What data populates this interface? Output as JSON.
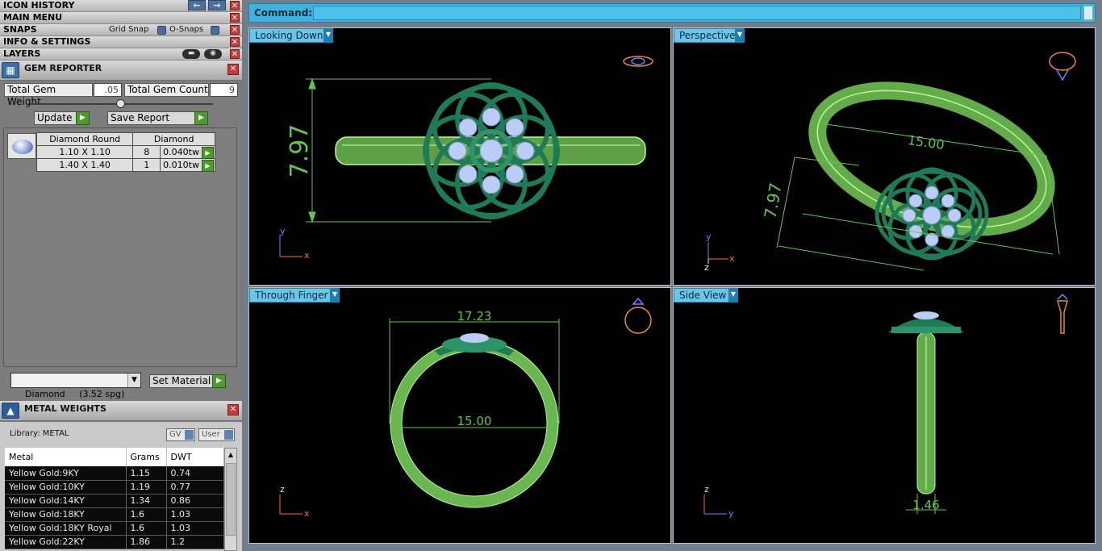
{
  "left_panel": {
    "icon_history": {
      "label": "ICON HISTORY"
    },
    "main_menu": {
      "label": "MAIN MENU"
    },
    "snaps": {
      "label": "SNAPS",
      "grid_snap": "Grid Snap",
      "o_snaps": "O-Snaps"
    },
    "info_settings": {
      "label": "INFO & SETTINGS"
    },
    "layers": {
      "label": "LAYERS"
    },
    "gem_reporter": {
      "title": "GEM REPORTER",
      "total_gem_weight_label": "Total Gem Weight",
      "total_gem_weight_value": ".05",
      "total_gem_count_label": "Total Gem Count",
      "total_gem_count_value": "9",
      "update_label": "Update",
      "save_report_label": "Save Report",
      "table_headers": [
        "Diamond Round",
        "Diamond"
      ],
      "rows": [
        {
          "size": "1.10 X 1.10",
          "count": "8",
          "weight": "0.040tw"
        },
        {
          "size": "1.40 X 1.40",
          "count": "1",
          "weight": "0.010tw"
        }
      ],
      "material_select": "Diamond     (3.52 spg)",
      "set_material_label": "Set Material"
    },
    "metal_weights": {
      "title": "METAL WEIGHTS",
      "library_label": "Library: METAL",
      "gv_label": "GV",
      "user_label": "User",
      "columns": [
        "Metal",
        "Grams",
        "DWT"
      ],
      "rows": [
        [
          "Yellow Gold:9KY",
          "1.15",
          "0.74"
        ],
        [
          "Yellow Gold:10KY",
          "1.19",
          "0.77"
        ],
        [
          "Yellow Gold:14KY",
          "1.34",
          "0.86"
        ],
        [
          "Yellow Gold:18KY",
          "1.6",
          "1.03"
        ],
        [
          "Yellow Gold:18KY Royal",
          "1.6",
          "1.03"
        ],
        [
          "Yellow Gold:22KY",
          "1.86",
          "1.2"
        ]
      ]
    }
  },
  "command": {
    "label": "Command:",
    "value": ""
  },
  "viewports": {
    "top_left": {
      "title": "Looking Down",
      "dim_height": "7.97",
      "axis_y": "y",
      "axis_x": "x"
    },
    "top_right": {
      "title": "Perspective",
      "dim_width": "15.00",
      "dim_height": "7.97",
      "axis_y": "y",
      "axis_x": "x",
      "axis_z": "z"
    },
    "bottom_left": {
      "title": "Through Finger",
      "dim_outer": "17.23",
      "dim_inner": "15.00",
      "axis_z": "z",
      "axis_x": "x"
    },
    "bottom_right": {
      "title": "Side View",
      "dim_width": "1.46",
      "axis_z": "z",
      "axis_y": "y"
    }
  },
  "colors": {
    "ring_green": "#9bf07a",
    "dim_green": "#63c451",
    "setting_green": "#1f7a56",
    "gem_blue": "#b9cdf5",
    "command_bar": "#3fb3de"
  }
}
